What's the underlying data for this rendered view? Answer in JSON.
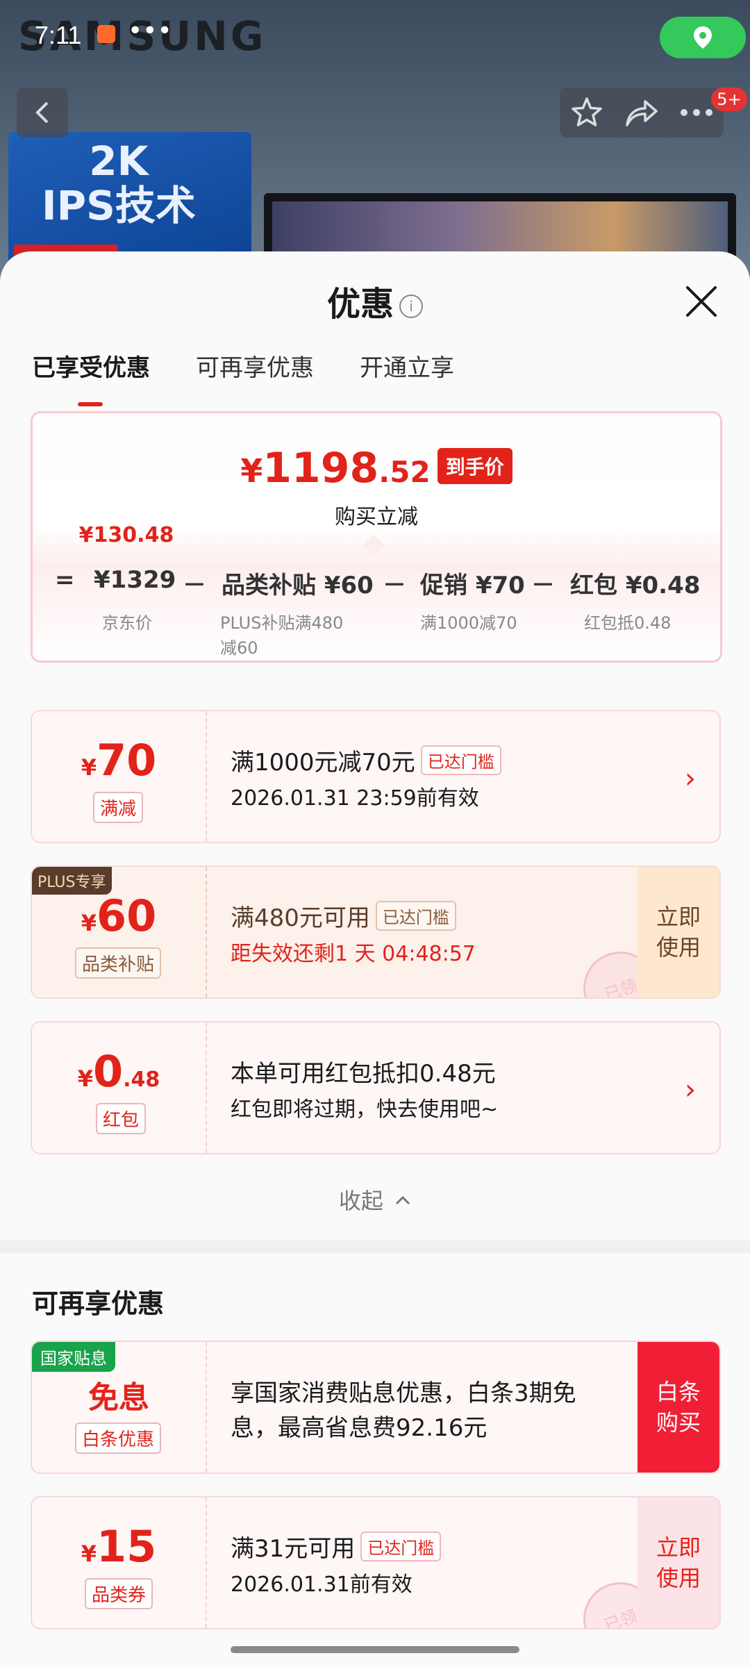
{
  "status_bar": {
    "time": "7:11",
    "dots": "•••"
  },
  "backdrop": {
    "brand": "SAMSUNG",
    "line1": "2K",
    "line2": "IPS技术"
  },
  "header": {
    "message_badge": "5+",
    "icons": [
      "back-icon",
      "star-icon",
      "share-icon",
      "more-icon",
      "location-icon"
    ]
  },
  "sheet": {
    "title": "优惠",
    "info_glyph": "i",
    "tabs": [
      {
        "label": "已享受优惠"
      },
      {
        "label": "可再享优惠"
      },
      {
        "label": "开通立享"
      }
    ],
    "summary": {
      "currency": "¥",
      "price_int": "1198",
      "price_dec": ".52",
      "price_tag": "到手价",
      "reduce_label": "购买立减",
      "reduce_amount": "¥130.48",
      "breakdown": [
        {
          "op": "=",
          "label": "¥1329",
          "sub": "京东价"
        },
        {
          "op": "－",
          "label": "品类补贴 ¥60",
          "sub": "PLUS补贴满480减60"
        },
        {
          "op": "－",
          "label": "促销 ¥70",
          "sub": "满1000减70"
        },
        {
          "op": "－",
          "label": "红包 ¥0.48",
          "sub": "红包抵0.48"
        }
      ]
    },
    "cards": [
      {
        "currency": "¥",
        "amount": "70",
        "type": "满减",
        "line1": "满1000元减70元",
        "badge": "已达门槛",
        "line2": "2026.01.31 23:59前有效",
        "action": "›"
      },
      {
        "tag": "PLUS专享",
        "currency": "¥",
        "amount": "60",
        "type": "品类补贴",
        "line1": "满480元可用",
        "badge": "已达门槛",
        "line2": "距失效还剩1 天 04:48:57",
        "action": "立即\n使用",
        "stamp": "已领"
      },
      {
        "currency": "¥",
        "amount": "0",
        "decimals": ".48",
        "type": "红包",
        "line1": "本单可用红包抵扣0.48元",
        "line2": "红包即将过期，快去使用吧~",
        "action": "›"
      }
    ],
    "collapse_label": "收起",
    "section2_title": "可再享优惠",
    "cards2": [
      {
        "tag": "国家贴息",
        "amount": "免息",
        "type": "白条优惠",
        "line1": "享国家消费贴息优惠，白条3期免",
        "line1b": "息，最高省息费92.16元",
        "action": "白条\n购买"
      },
      {
        "currency": "¥",
        "amount": "15",
        "type": "品类券",
        "line1": "满31元可用",
        "badge": "已达门槛",
        "line2": "2026.01.31前有效",
        "action": "立即\n使用",
        "stamp": "已领"
      }
    ]
  },
  "colors": {
    "accent": "#e2231a",
    "green": "#19a34a",
    "plus_brown": "#5a3c2b"
  }
}
